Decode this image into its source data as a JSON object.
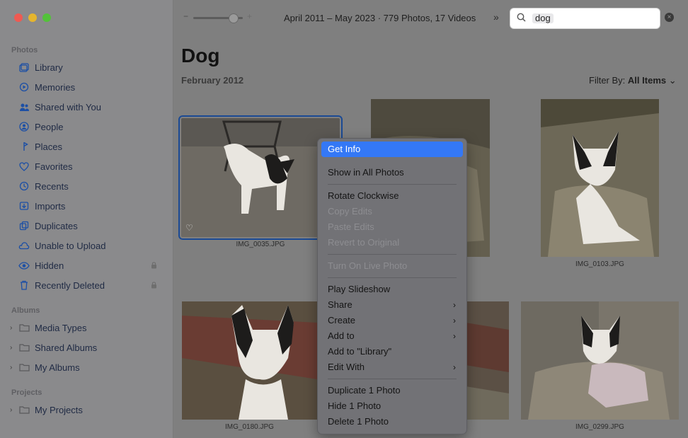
{
  "window": {
    "controls": {
      "close_color": "#ef5a52",
      "minimize_color": "#e5b52e",
      "zoom_color": "#53c23a"
    }
  },
  "sidebar": {
    "photos_title": "Photos",
    "items": [
      {
        "label": "Library",
        "icon": "library-icon"
      },
      {
        "label": "Memories",
        "icon": "memories-icon"
      },
      {
        "label": "Shared with You",
        "icon": "shared-with-you-icon"
      },
      {
        "label": "People",
        "icon": "people-icon"
      },
      {
        "label": "Places",
        "icon": "places-icon"
      },
      {
        "label": "Favorites",
        "icon": "heart-icon"
      },
      {
        "label": "Recents",
        "icon": "clock-icon"
      },
      {
        "label": "Imports",
        "icon": "imports-icon"
      },
      {
        "label": "Duplicates",
        "icon": "duplicates-icon"
      },
      {
        "label": "Unable to Upload",
        "icon": "cloud-icon"
      },
      {
        "label": "Hidden",
        "icon": "eye-icon",
        "locked": true
      },
      {
        "label": "Recently Deleted",
        "icon": "trash-icon",
        "locked": true
      }
    ],
    "albums_title": "Albums",
    "albums": [
      {
        "label": "Media Types"
      },
      {
        "label": "Shared Albums"
      },
      {
        "label": "My Albums"
      }
    ],
    "projects_title": "Projects",
    "projects": [
      {
        "label": "My Projects"
      }
    ]
  },
  "toolbar": {
    "zoom_minus": "−",
    "zoom_plus": "+",
    "range": "April 2011 – May 2023 · 779 Photos, 17 Videos",
    "more": "»",
    "search_value": "dog",
    "clear_label": "×"
  },
  "main": {
    "title": "Dog",
    "date_header": "February 2012",
    "filter_label": "Filter By:",
    "filter_value": "All Items",
    "photos": [
      {
        "caption": "IMG_0035.JPG"
      },
      {
        "caption": ""
      },
      {
        "caption": "IMG_0103.JPG"
      },
      {
        "caption": "IMG_0180.JPG"
      },
      {
        "caption": ""
      },
      {
        "caption": "IMG_0299.JPG"
      }
    ]
  },
  "context_menu": {
    "items": [
      {
        "label": "Get Info",
        "state": "highlighted"
      },
      {
        "label": "Show in All Photos"
      },
      {
        "label": "Rotate Clockwise"
      },
      {
        "label": "Copy Edits",
        "state": "disabled"
      },
      {
        "label": "Paste Edits",
        "state": "disabled"
      },
      {
        "label": "Revert to Original",
        "state": "disabled"
      },
      {
        "label": "Turn On Live Photo",
        "state": "disabled"
      },
      {
        "label": "Play Slideshow"
      },
      {
        "label": "Share",
        "submenu": true
      },
      {
        "label": "Create",
        "submenu": true
      },
      {
        "label": "Add to",
        "submenu": true
      },
      {
        "label": "Add to \"Library\""
      },
      {
        "label": "Edit With",
        "submenu": true
      },
      {
        "label": "Duplicate 1 Photo"
      },
      {
        "label": "Hide 1 Photo"
      },
      {
        "label": "Delete 1 Photo"
      }
    ],
    "submenu_arrow": "›",
    "highlight_color": "#3478f6"
  }
}
